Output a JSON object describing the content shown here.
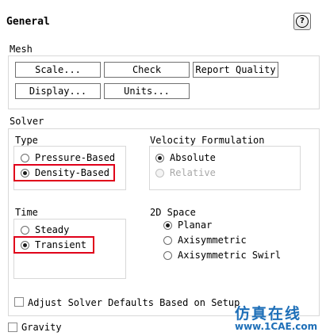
{
  "panel": {
    "title": "General",
    "help_icon_glyph": "?"
  },
  "mesh": {
    "label": "Mesh",
    "buttons": {
      "scale": "Scale...",
      "check": "Check",
      "report_quality": "Report Quality",
      "display": "Display...",
      "units": "Units..."
    }
  },
  "solver": {
    "label": "Solver",
    "type": {
      "label": "Type",
      "options": [
        "Pressure-Based",
        "Density-Based"
      ],
      "selected": "Density-Based"
    },
    "velocity_formulation": {
      "label": "Velocity Formulation",
      "options": [
        "Absolute",
        "Relative"
      ],
      "selected": "Absolute",
      "disabled": [
        "Relative"
      ]
    },
    "time": {
      "label": "Time",
      "options": [
        "Steady",
        "Transient"
      ],
      "selected": "Transient"
    },
    "space_2d": {
      "label": "2D Space",
      "options": [
        "Planar",
        "Axisymmetric",
        "Axisymmetric Swirl"
      ],
      "selected": "Planar"
    },
    "adjust_defaults_label": "Adjust Solver Defaults Based on Setup"
  },
  "gravity": {
    "label": "Gravity",
    "checked": false
  },
  "watermark": {
    "cn": "仿真在线",
    "url": "www.1CAE.com"
  },
  "colors": {
    "highlight": "#e0001a",
    "watermark_blue": "#1e6fb8"
  }
}
